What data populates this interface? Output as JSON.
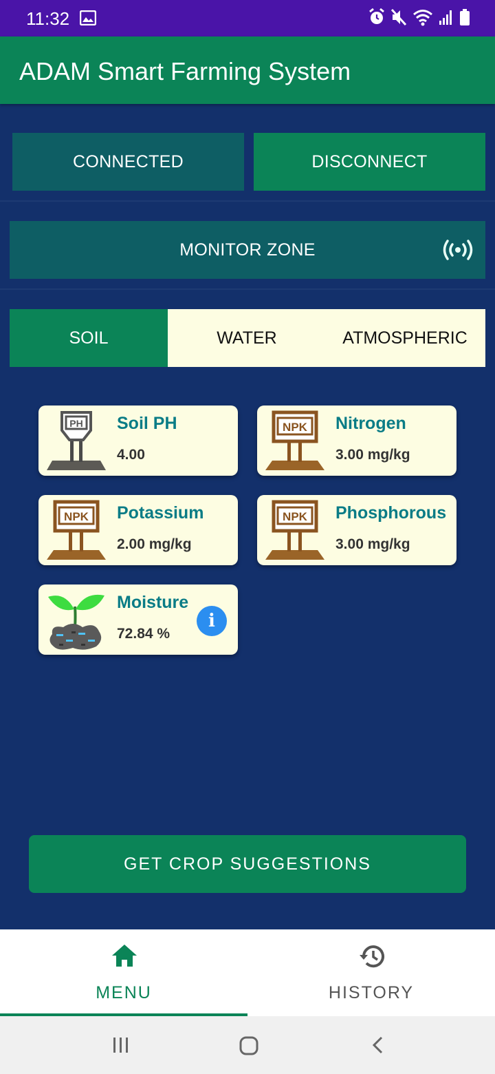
{
  "status_bar": {
    "time": "11:32"
  },
  "app": {
    "title": "ADAM Smart Farming System"
  },
  "connection": {
    "connected_label": "CONNECTED",
    "disconnect_label": "DISCONNECT"
  },
  "monitor": {
    "label": "MONITOR ZONE"
  },
  "tabs": [
    {
      "label": "SOIL",
      "active": true
    },
    {
      "label": "WATER",
      "active": false
    },
    {
      "label": "ATMOSPHERIC",
      "active": false
    }
  ],
  "cards": [
    {
      "label": "Soil PH",
      "value": "4.00",
      "icon": "ph-sensor-icon"
    },
    {
      "label": "Nitrogen",
      "value": "3.00 mg/kg",
      "icon": "npk-sensor-icon"
    },
    {
      "label": "Potassium",
      "value": "2.00 mg/kg",
      "icon": "npk-sensor-icon"
    },
    {
      "label": "Phosphorous",
      "value": "3.00 mg/kg",
      "icon": "npk-sensor-icon"
    },
    {
      "label": "Moisture",
      "value": "72.84 %",
      "icon": "sprout-soil-icon",
      "info_glyph": "i"
    }
  ],
  "actions": {
    "crop_suggestions_label": "GET CROP SUGGESTIONS"
  },
  "bottom_nav": [
    {
      "label": "MENU",
      "icon": "home-icon",
      "active": true
    },
    {
      "label": "HISTORY",
      "icon": "history-icon",
      "active": false
    }
  ],
  "colors": {
    "primary": "#0b8457",
    "teal": "#0e5e64",
    "background": "#13306b",
    "card": "#fdfde2",
    "status_bar": "#4a14a8"
  }
}
